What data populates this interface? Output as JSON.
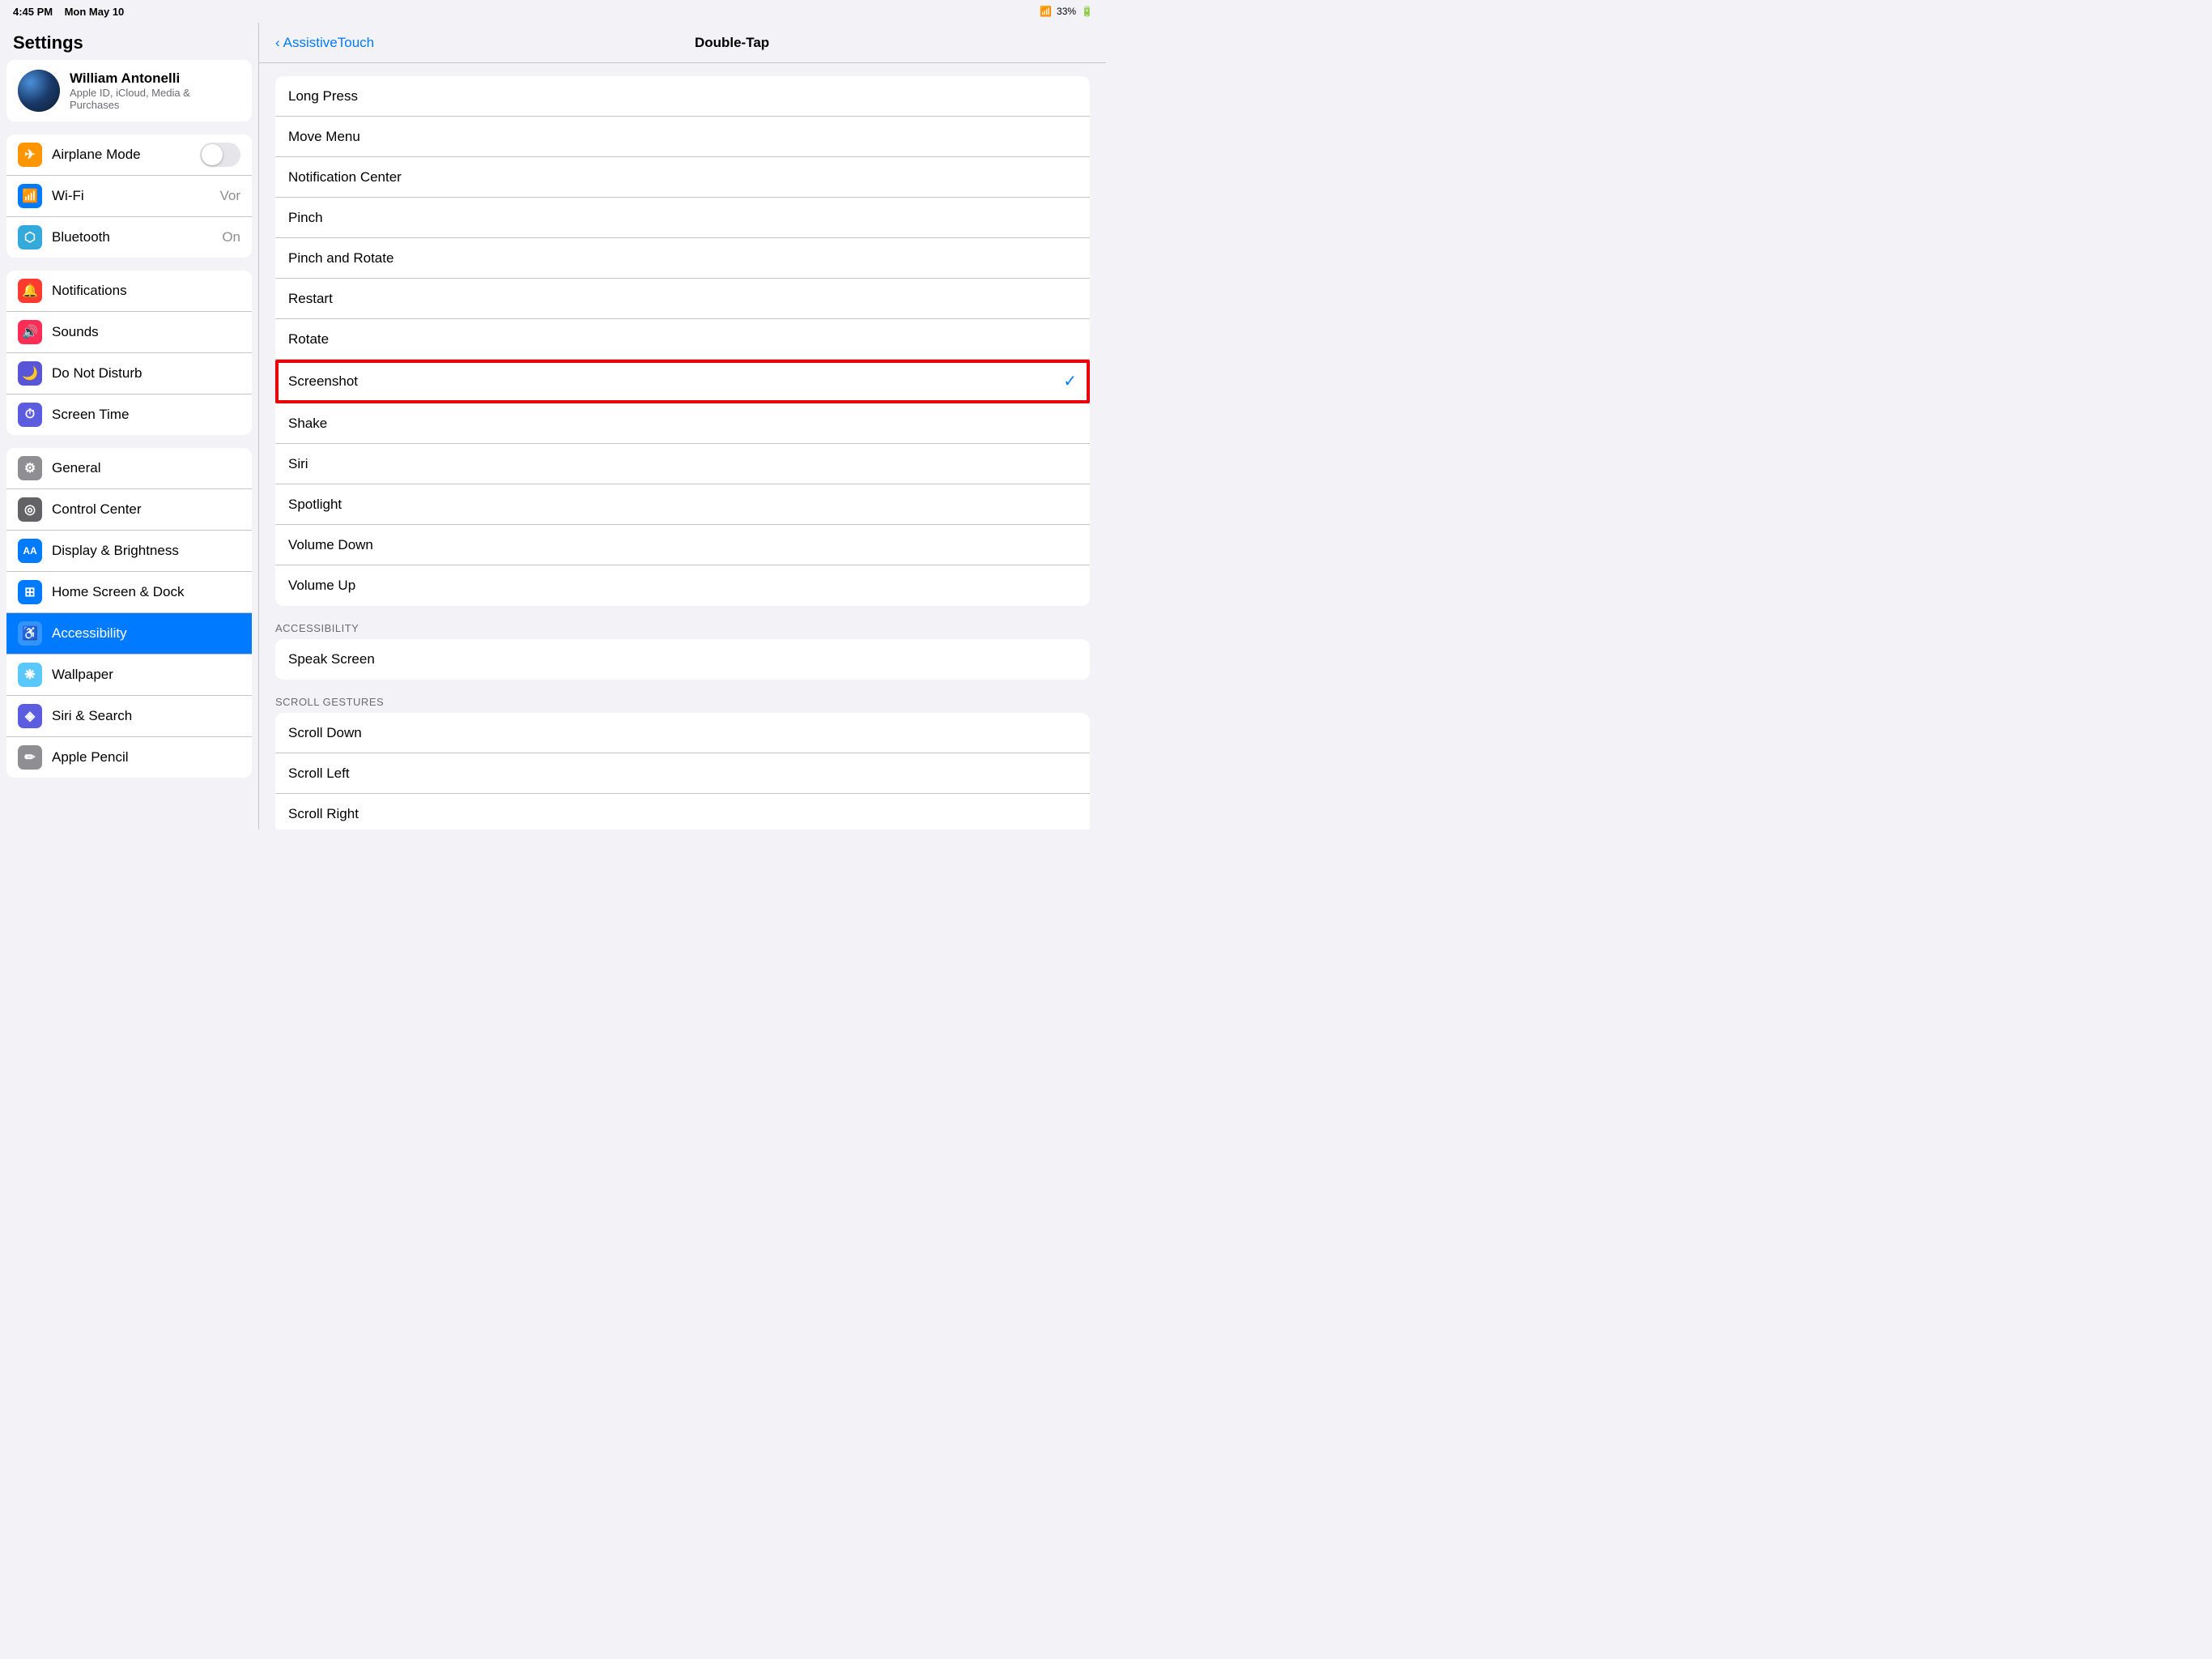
{
  "statusBar": {
    "time": "4:45 PM",
    "date": "Mon May 10",
    "wifi": "WiFi",
    "battery": "33%"
  },
  "sidebar": {
    "title": "Settings",
    "profile": {
      "name": "William Antonelli",
      "subtitle": "Apple ID, iCloud, Media & Purchases"
    },
    "group1": [
      {
        "id": "airplane",
        "label": "Airplane Mode",
        "value": "",
        "hasToggle": true,
        "iconColor": "icon-orange",
        "iconSymbol": "✈"
      },
      {
        "id": "wifi",
        "label": "Wi-Fi",
        "value": "Vor",
        "hasToggle": false,
        "iconColor": "icon-blue",
        "iconSymbol": "📶"
      },
      {
        "id": "bluetooth",
        "label": "Bluetooth",
        "value": "On",
        "hasToggle": false,
        "iconColor": "icon-blue2",
        "iconSymbol": "⬡"
      }
    ],
    "group2": [
      {
        "id": "notifications",
        "label": "Notifications",
        "value": "",
        "iconColor": "icon-red",
        "iconSymbol": "🔔"
      },
      {
        "id": "sounds",
        "label": "Sounds",
        "value": "",
        "iconColor": "icon-pink",
        "iconSymbol": "🔊"
      },
      {
        "id": "donotdisturb",
        "label": "Do Not Disturb",
        "value": "",
        "iconColor": "icon-purple",
        "iconSymbol": "🌙"
      },
      {
        "id": "screentime",
        "label": "Screen Time",
        "value": "",
        "iconColor": "icon-indigo",
        "iconSymbol": "⏱"
      }
    ],
    "group3": [
      {
        "id": "general",
        "label": "General",
        "value": "",
        "iconColor": "icon-gray",
        "iconSymbol": "⚙"
      },
      {
        "id": "controlcenter",
        "label": "Control Center",
        "value": "",
        "iconColor": "icon-gray2",
        "iconSymbol": "◎"
      },
      {
        "id": "display",
        "label": "Display & Brightness",
        "value": "",
        "iconColor": "icon-blue3",
        "iconSymbol": "AA"
      },
      {
        "id": "homescreen",
        "label": "Home Screen & Dock",
        "value": "",
        "iconColor": "icon-blue3",
        "iconSymbol": "⊞"
      },
      {
        "id": "accessibility",
        "label": "Accessibility",
        "value": "",
        "iconColor": "icon-blue3",
        "iconSymbol": "♿",
        "active": true
      },
      {
        "id": "wallpaper",
        "label": "Wallpaper",
        "value": "",
        "iconColor": "icon-teal",
        "iconSymbol": "❋"
      },
      {
        "id": "siri",
        "label": "Siri & Search",
        "value": "",
        "iconColor": "icon-indigo",
        "iconSymbol": "◈"
      },
      {
        "id": "applepencil",
        "label": "Apple Pencil",
        "value": "",
        "iconColor": "icon-gray",
        "iconSymbol": "✏"
      }
    ]
  },
  "navBar": {
    "backLabel": "AssistiveTouch",
    "title": "Double-Tap"
  },
  "listGroups": {
    "mainItems": [
      {
        "id": "longpress",
        "label": "Long Press",
        "checked": false
      },
      {
        "id": "movemenu",
        "label": "Move Menu",
        "checked": false
      },
      {
        "id": "notificationcenter",
        "label": "Notification Center",
        "checked": false
      },
      {
        "id": "pinch",
        "label": "Pinch",
        "checked": false
      },
      {
        "id": "pinchandrotate",
        "label": "Pinch and Rotate",
        "checked": false
      },
      {
        "id": "restart",
        "label": "Restart",
        "checked": false
      },
      {
        "id": "rotate",
        "label": "Rotate",
        "checked": false,
        "partial": true
      },
      {
        "id": "screenshot",
        "label": "Screenshot",
        "checked": true,
        "highlighted": true
      },
      {
        "id": "shake",
        "label": "Shake",
        "checked": false
      },
      {
        "id": "siri",
        "label": "Siri",
        "checked": false
      },
      {
        "id": "spotlight",
        "label": "Spotlight",
        "checked": false
      },
      {
        "id": "volumedown",
        "label": "Volume Down",
        "checked": false
      },
      {
        "id": "volumeup",
        "label": "Volume Up",
        "checked": false
      }
    ],
    "accessibility": {
      "header": "ACCESSIBILITY",
      "items": [
        {
          "id": "speakscreen",
          "label": "Speak Screen",
          "checked": false
        }
      ]
    },
    "scrollGestures": {
      "header": "SCROLL GESTURES",
      "items": [
        {
          "id": "scrolldown",
          "label": "Scroll Down",
          "checked": false
        },
        {
          "id": "scrollleft",
          "label": "Scroll Left",
          "checked": false
        },
        {
          "id": "scrollright",
          "label": "Scroll Right",
          "checked": false
        }
      ]
    }
  }
}
